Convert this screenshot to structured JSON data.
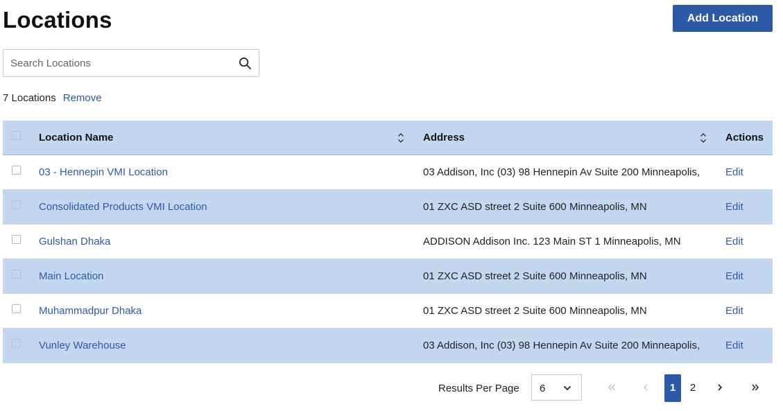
{
  "header": {
    "title": "Locations",
    "add_button": "Add Location"
  },
  "search": {
    "placeholder": "Search Locations"
  },
  "summary": {
    "count": "7 Locations",
    "remove": "Remove"
  },
  "table": {
    "columns": {
      "name": "Location Name",
      "address": "Address",
      "actions": "Actions"
    },
    "rows": [
      {
        "name": "03 - Hennepin VMI Location",
        "address": "03 Addison, Inc (03) 98 Hennepin Av Suite 200 Minneapolis,",
        "action": "Edit"
      },
      {
        "name": "Consolidated Products VMI Location",
        "address": "01 ZXC ASD street 2 Suite 600 Minneapolis, MN",
        "action": "Edit"
      },
      {
        "name": "Gulshan Dhaka",
        "address": "ADDISON Addison Inc. 123 Main ST 1 Minneapolis, MN",
        "action": "Edit"
      },
      {
        "name": "Main Location",
        "address": "01 ZXC ASD street 2 Suite 600 Minneapolis, MN",
        "action": "Edit"
      },
      {
        "name": "Muhammadpur Dhaka",
        "address": "01 ZXC ASD street 2 Suite 600 Minneapolis, MN",
        "action": "Edit"
      },
      {
        "name": "Vunley Warehouse",
        "address": "03 Addison, Inc (03) 98 Hennepin Av Suite 200 Minneapolis,",
        "action": "Edit"
      }
    ]
  },
  "pagination": {
    "results_per_page_label": "Results Per Page",
    "results_per_page_value": "6",
    "pages": [
      "1",
      "2"
    ],
    "current_page": "1"
  },
  "colors": {
    "accent": "#2c5aa8",
    "row_alt": "#c3d8f0"
  }
}
